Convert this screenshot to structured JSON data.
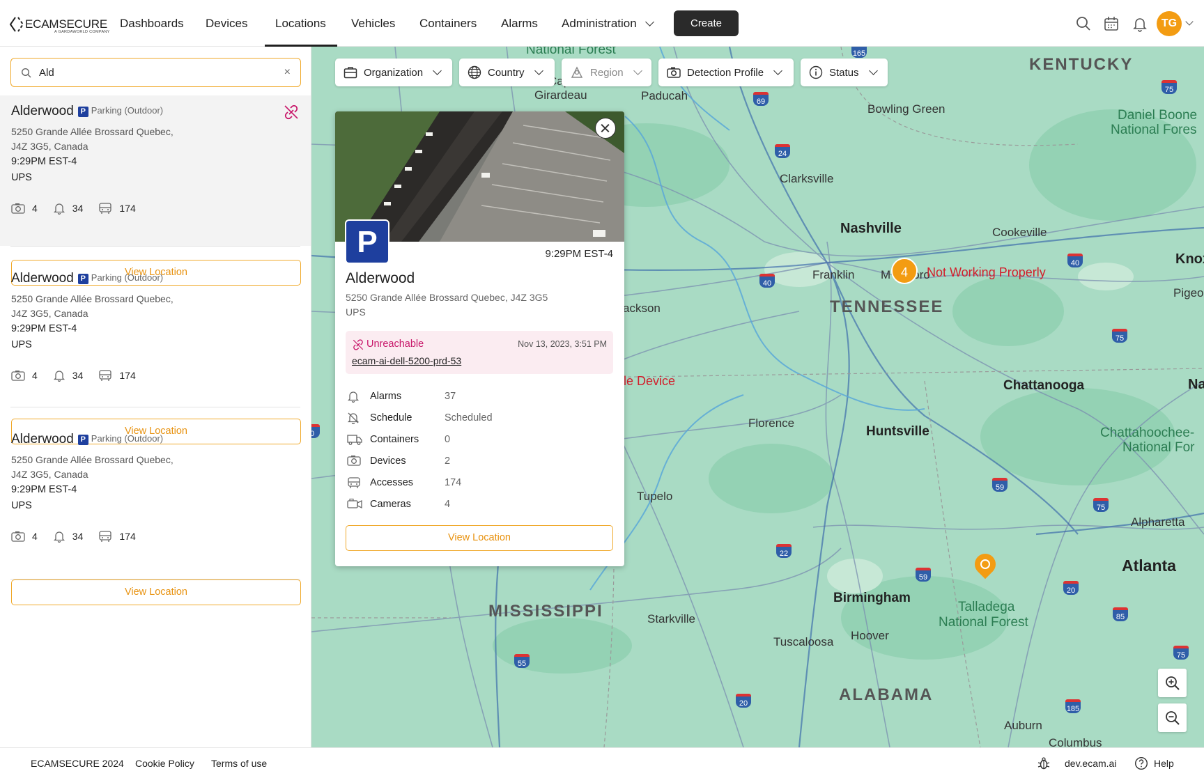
{
  "app": {
    "brand": "ECAMSECURE",
    "brand_sub": "A GARDAWORLD COMPANY"
  },
  "nav": {
    "items": [
      {
        "label": "Dashboards"
      },
      {
        "label": "Devices"
      },
      {
        "label": "Locations"
      },
      {
        "label": "Vehicles"
      },
      {
        "label": "Containers"
      },
      {
        "label": "Alarms"
      },
      {
        "label": "Administration"
      }
    ],
    "active": "Locations",
    "create_label": "Create",
    "avatar_initials": "TG"
  },
  "search": {
    "value": "Ald",
    "placeholder": ""
  },
  "locations": [
    {
      "name": "Alderwood",
      "badge": "P",
      "type": "Parking (Outdoor)",
      "address_line1": "5250 Grande Allée Brossard Quebec,",
      "address_line2": "J4Z 3G5, Canada",
      "time": "9:29PM EST-4",
      "org": "UPS",
      "cameras": "4",
      "alarms": "34",
      "accesses": "174",
      "button": "View Location",
      "selected": true,
      "unreachable": true
    },
    {
      "name": "Alderwood",
      "badge": "P",
      "type": "Parking (Outdoor)",
      "address_line1": "5250 Grande Allée Brossard Quebec,",
      "address_line2": "J4Z 3G5, Canada",
      "time": "9:29PM EST-4",
      "org": "UPS",
      "cameras": "4",
      "alarms": "34",
      "accesses": "174",
      "button": "View Location",
      "selected": false,
      "unreachable": false
    },
    {
      "name": "Alderwood",
      "badge": "P",
      "type": "Parking (Outdoor)",
      "address_line1": "5250 Grande Allée Brossard Quebec,",
      "address_line2": "J4Z 3G5, Canada",
      "time": "9:29PM EST-4",
      "org": "UPS",
      "cameras": "4",
      "alarms": "34",
      "accesses": "174",
      "button": "View Location",
      "selected": false,
      "unreachable": false
    }
  ],
  "filters": [
    {
      "label": "Organization",
      "icon": "briefcase-icon",
      "disabled": false
    },
    {
      "label": "Country",
      "icon": "globe-icon",
      "disabled": false
    },
    {
      "label": "Region",
      "icon": "region-icon",
      "disabled": true
    },
    {
      "label": "Detection Profile",
      "icon": "camera-icon",
      "disabled": false
    },
    {
      "label": "Status",
      "icon": "info-icon",
      "disabled": false
    }
  ],
  "popup": {
    "badge": "P",
    "time": "9:29PM EST-4",
    "name": "Alderwood",
    "address": "5250 Grande Allée Brossard Quebec, J4Z 3G5",
    "org": "UPS",
    "alert": {
      "status": "Unreachable",
      "date": "Nov 13, 2023, 3:51 PM",
      "device": "ecam-ai-dell-5200-prd-53"
    },
    "rows": [
      {
        "label": "Alarms",
        "value": "37"
      },
      {
        "label": "Schedule",
        "value": "Scheduled"
      },
      {
        "label": "Containers",
        "value": "0"
      },
      {
        "label": "Devices",
        "value": "2"
      },
      {
        "label": "Accesses",
        "value": "174"
      },
      {
        "label": "Cameras",
        "value": "4"
      }
    ],
    "button": "View Location"
  },
  "map": {
    "labels": {
      "national_forest_top": "National Forest",
      "cape_girardeau_1": "Cape",
      "cape_girardeau_2": "Girardeau",
      "paducah": "Paducah",
      "kentucky": "KENTUCKY",
      "bowling_green": "Bowling Green",
      "daniel_boone_1": "Daniel Boone",
      "daniel_boone_2": "National Fores",
      "clarksville": "Clarksville",
      "nashville": "Nashville",
      "cookeville": "Cookeville",
      "knox": "Knox",
      "franklin": "Franklin",
      "murfreesboro": "M          esboro",
      "pigeon": "Pigeon",
      "tennessee": "TENNESSEE",
      "jackson": "ackson",
      "chattanooga": "Chattanooga",
      "na": "Na",
      "florence": "Florence",
      "huntsville": "Huntsville",
      "chattahoochee_1": "Chattahoochee-",
      "chattahoochee_2": "National For",
      "tupelo": "Tupelo",
      "alpharetta": "Alpharetta",
      "atlanta": "Atlanta",
      "mississippi": "MISSISSIPPI",
      "starkville": "Starkville",
      "birmingham": "Birmingham",
      "hoover": "Hoover",
      "talladega_1": "Talladega",
      "talladega_2": "National Forest",
      "tuscaloosa": "Tuscaloosa",
      "alabama": "ALABAMA",
      "auburn": "Auburn",
      "columbus": "Columbus",
      "not_working": "Not Working Properly",
      "le_device": "le Device"
    },
    "cluster_count": "4",
    "shields": [
      "165",
      "75",
      "69",
      "24",
      "40",
      "40",
      "75",
      "59",
      "75",
      "22",
      "59",
      "20",
      "85",
      "55",
      "20",
      "185",
      "75",
      "0"
    ]
  },
  "footer": {
    "copyright": "ECAMSECURE 2024",
    "cookie": "Cookie Policy",
    "terms": "Terms of use",
    "domain": "dev.ecam.ai",
    "help": "Help"
  },
  "colors": {
    "accent": "#f0a92b",
    "brand_blue": "#1e3f9e",
    "alert_pink": "#c8176a",
    "map_green": "#a9dbc4",
    "map_red": "#d21e2b"
  }
}
